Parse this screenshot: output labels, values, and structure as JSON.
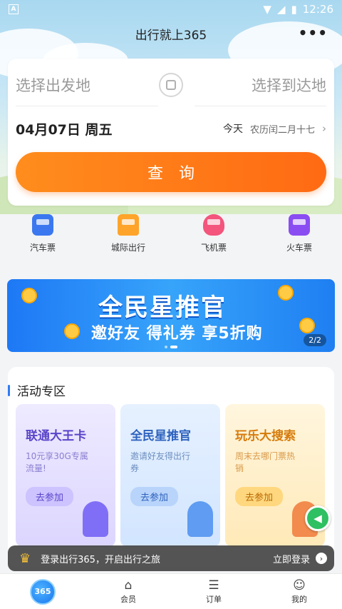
{
  "status_bar": {
    "time": "12:26",
    "notif_icon": "A"
  },
  "app_bar": {
    "title": "出行就上365",
    "more_glyph": "•••"
  },
  "search": {
    "from_placeholder": "选择出发地",
    "to_placeholder": "选择到达地",
    "date": "04月07日 周五",
    "today": "今天",
    "lunar": "农历闰二月十七",
    "chevron": "›",
    "query_button": "查询",
    "swap_icon": "bus-swap-icon"
  },
  "categories": [
    {
      "label": "汽车票",
      "icon": "bus-icon",
      "color": "#3b78f0"
    },
    {
      "label": "城际出行",
      "icon": "car-icon",
      "color": "#ffa42a"
    },
    {
      "label": "飞机票",
      "icon": "plane-icon",
      "color": "#f3557c"
    },
    {
      "label": "火车票",
      "icon": "train-icon",
      "color": "#8a4df2"
    }
  ],
  "banner": {
    "title": "全民星推官",
    "subtitle": "邀好友 得礼券 享5折购",
    "pager": "2/2"
  },
  "activity": {
    "section_title": "活动专区",
    "tiles": [
      {
        "title": "联通大王卡",
        "desc": "10元享30G专属流量!",
        "button": "去参加"
      },
      {
        "title": "全民星推官",
        "desc": "邀请好友得出行券",
        "button": "去参加"
      },
      {
        "title": "玩乐大搜索",
        "desc": "周末去哪门票热销",
        "button": "去参加"
      }
    ]
  },
  "login_bar": {
    "text": "登录出行365，开启出行之旅",
    "action": "立即登录",
    "arrow": "›"
  },
  "tabbar": [
    {
      "label": "",
      "icon": "home-365-logo",
      "logo_text": "365"
    },
    {
      "label": "会员",
      "icon": "member-icon",
      "glyph": "⌂"
    },
    {
      "label": "订单",
      "icon": "order-icon",
      "glyph": "☰"
    },
    {
      "label": "我的",
      "icon": "profile-icon",
      "glyph": "☺"
    }
  ]
}
